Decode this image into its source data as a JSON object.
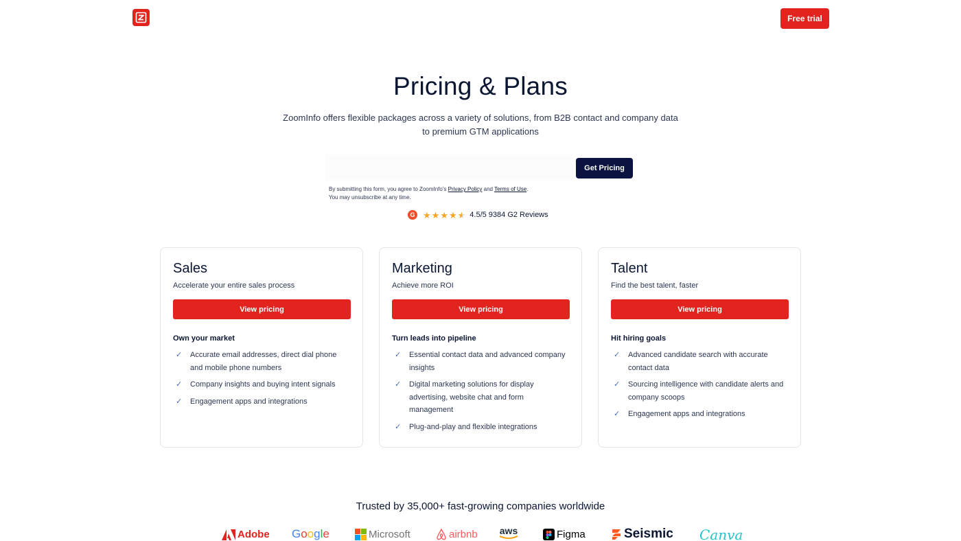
{
  "header": {
    "logo_icon": "zoominfo-z-icon",
    "free_trial_label": "Free trial"
  },
  "hero": {
    "title": "Pricing & Plans",
    "subtitle": "ZoomInfo offers flexible packages across a variety of solutions, from B2B contact and company data to premium GTM applications"
  },
  "form": {
    "email_placeholder": "",
    "submit_label": "Get Pricing",
    "disclaimer_prefix": "By submitting this form, you agree to ZoomInfo's ",
    "privacy_link": "Privacy Policy",
    "and": " and ",
    "terms_link": "Terms of Use",
    "disclaimer_suffix": ".",
    "unsubscribe": "You may unsubscribe at any time."
  },
  "rating": {
    "g2_letter": "G",
    "stars": 4.5,
    "text": "4.5/5 9384 G2 Reviews"
  },
  "plans": [
    {
      "title": "Sales",
      "tagline": "Accelerate your entire sales process",
      "button": "View pricing",
      "heading": "Own your market",
      "features": [
        "Accurate email addresses, direct dial phone and mobile phone numbers",
        "Company insights and buying intent signals",
        "Engagement apps and integrations"
      ]
    },
    {
      "title": "Marketing",
      "tagline": "Achieve more ROI",
      "button": "View pricing",
      "heading": "Turn leads into pipeline",
      "features": [
        "Essential contact data and advanced company insights",
        "Digital marketing solutions for display advertising, website chat and form management",
        "Plug-and-play and flexible integrations"
      ]
    },
    {
      "title": "Talent",
      "tagline": "Find the best talent, faster",
      "button": "View pricing",
      "heading": "Hit hiring goals",
      "features": [
        "Advanced candidate search with accurate contact data",
        "Sourcing intelligence with candidate alerts and company scoops",
        "Engagement apps and integrations"
      ]
    }
  ],
  "trusted": {
    "text": "Trusted by 35,000+ fast-growing companies worldwide",
    "logos": [
      "Adobe",
      "Google",
      "Microsoft",
      "airbnb",
      "aws",
      "Figma",
      "Seismic",
      "Canva"
    ]
  },
  "colors": {
    "brand_red": "#e3231e",
    "navy": "#0b1340",
    "check_blue": "#4a6cb3",
    "star_gold": "#f5a623"
  }
}
